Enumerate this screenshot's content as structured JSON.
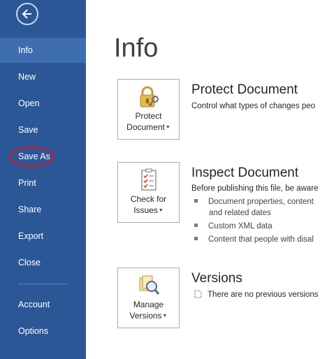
{
  "sidebar": {
    "items": [
      {
        "label": "Info"
      },
      {
        "label": "New"
      },
      {
        "label": "Open"
      },
      {
        "label": "Save"
      },
      {
        "label": "Save As"
      },
      {
        "label": "Print"
      },
      {
        "label": "Share"
      },
      {
        "label": "Export"
      },
      {
        "label": "Close"
      },
      {
        "label": "Account"
      },
      {
        "label": "Options"
      }
    ]
  },
  "main": {
    "title": "Info",
    "protect": {
      "button_line1": "Protect",
      "button_line2": "Document",
      "heading": "Protect Document",
      "description": "Control what types of changes peo"
    },
    "inspect": {
      "button_line1": "Check for",
      "button_line2": "Issues",
      "heading": "Inspect Document",
      "description": "Before publishing this file, be aware",
      "bullets": [
        "Document properties, content",
        "and related dates",
        "Custom XML data",
        "Content that people with disal"
      ]
    },
    "versions": {
      "button_line1": "Manage",
      "button_line2": "Versions",
      "heading": "Versions",
      "description": "There are no previous versions"
    }
  },
  "colors": {
    "sidebar": "#2b5797",
    "selected": "#3f6eb0",
    "highlight_circle": "#e2141c"
  }
}
